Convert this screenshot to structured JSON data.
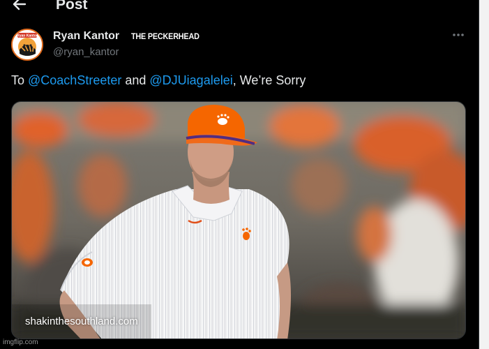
{
  "header": {
    "title": "Post",
    "back_icon": "arrow-left-icon"
  },
  "post": {
    "author": {
      "display_name": "Ryan Kantor",
      "caption": "THE PECKERHEAD",
      "handle": "@ryan_kantor",
      "avatar_logo_text": "Ryan Kantor"
    },
    "more_icon": "more-horizontal-icon",
    "text": {
      "prefix": "To ",
      "mention_1": "@CoachStreeter",
      "middle": " and ",
      "mention_2": "@DJUiagalelei",
      "suffix": ", We’re Sorry"
    },
    "media": {
      "watermark": "shakinthesouthland.com"
    }
  },
  "footer": {
    "imgflip_watermark": "imgflip.com"
  },
  "colors": {
    "background": "#000000",
    "text": "#e7e9ea",
    "secondary": "#71767b",
    "link": "#1d9bf0",
    "clemson_orange": "#f56600",
    "clemson_purple": "#522d80"
  }
}
